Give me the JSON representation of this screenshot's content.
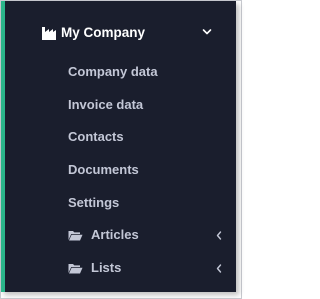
{
  "menu": {
    "title": "My Company",
    "title_icon": "factory-icon",
    "expand_icon": "chevron-down-icon",
    "items": [
      {
        "label": "Company data"
      },
      {
        "label": "Invoice data"
      },
      {
        "label": "Contacts"
      },
      {
        "label": "Documents"
      },
      {
        "label": "Settings"
      }
    ],
    "folders": [
      {
        "label": "Articles",
        "icon": "folder-open-icon",
        "expand_icon": "chevron-left-icon"
      },
      {
        "label": "Lists",
        "icon": "folder-open-icon",
        "expand_icon": "chevron-left-icon"
      }
    ]
  },
  "colors": {
    "panel_background": "#1a1e2d",
    "accent": "#2bb58a",
    "title_text": "#ffffff",
    "item_text": "#c3c7d6"
  }
}
